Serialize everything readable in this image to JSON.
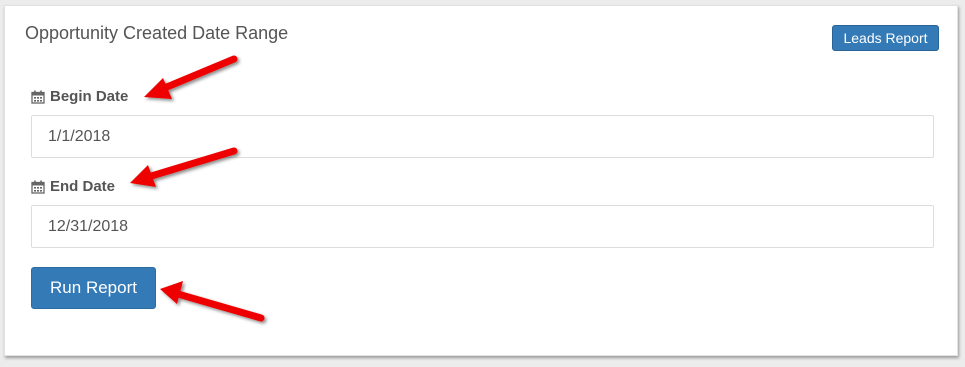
{
  "panel": {
    "title": "Opportunity Created Date Range",
    "leads_report_label": "Leads Report"
  },
  "begin_date": {
    "label": "Begin Date",
    "icon": "calendar-icon",
    "value": "1/1/2018"
  },
  "end_date": {
    "label": "End Date",
    "icon": "calendar-icon",
    "value": "12/31/2018"
  },
  "run_report_label": "Run Report",
  "colors": {
    "primary": "#337ab7",
    "annotation_arrow": "#ee0000"
  }
}
